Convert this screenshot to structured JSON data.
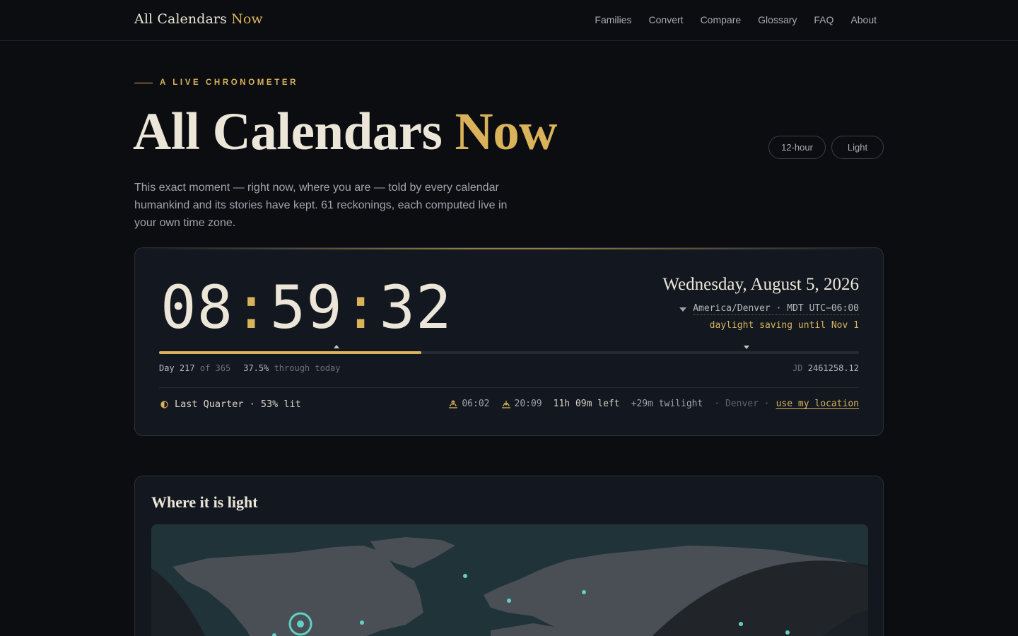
{
  "nav": {
    "brand_main": "All Calendars",
    "brand_accent": "Now",
    "links": [
      "Families",
      "Convert",
      "Compare",
      "Glossary",
      "FAQ",
      "About"
    ]
  },
  "hero": {
    "eyebrow": "A LIVE CHRONOMETER",
    "title_main": "All Calendars",
    "title_accent": "Now",
    "toggle_hour": "12-hour",
    "toggle_theme": "Light",
    "intro": "This exact moment — right now, where you are — told by every calendar humankind and its stories have kept. 61 reckonings, each computed live in your own time zone."
  },
  "clock": {
    "hours": "08",
    "minutes": "59",
    "seconds": "32",
    "separator": ":",
    "date": "Wednesday, August 5, 2026",
    "timezone": "America/Denver · MDT UTC−06:00",
    "dst": "daylight saving until Nov 1",
    "day_of_year": "217",
    "days_in_year": "365",
    "day_label": "Day",
    "of_label": "of",
    "percent_through": "37.5%",
    "through_label": "through today",
    "year_progress": 0.375,
    "jd_label": "JD",
    "jd_value": "2461258.12"
  },
  "sun_moon": {
    "moon_phase": "Last Quarter · 53% lit",
    "sunrise": "06:02",
    "sunset": "20:09",
    "daylight_left": "11h 09m left",
    "twilight": "+29m twilight",
    "city": "· Denver ·",
    "use_location": "use my location"
  },
  "map": {
    "title": "Where it is light"
  },
  "colors": {
    "accent": "#d9b25a",
    "background": "#0b0d11",
    "card": "#131820",
    "map_ocean": "#1f3338",
    "map_land": "#4a4f55",
    "city_dot": "#5fd1c6"
  }
}
